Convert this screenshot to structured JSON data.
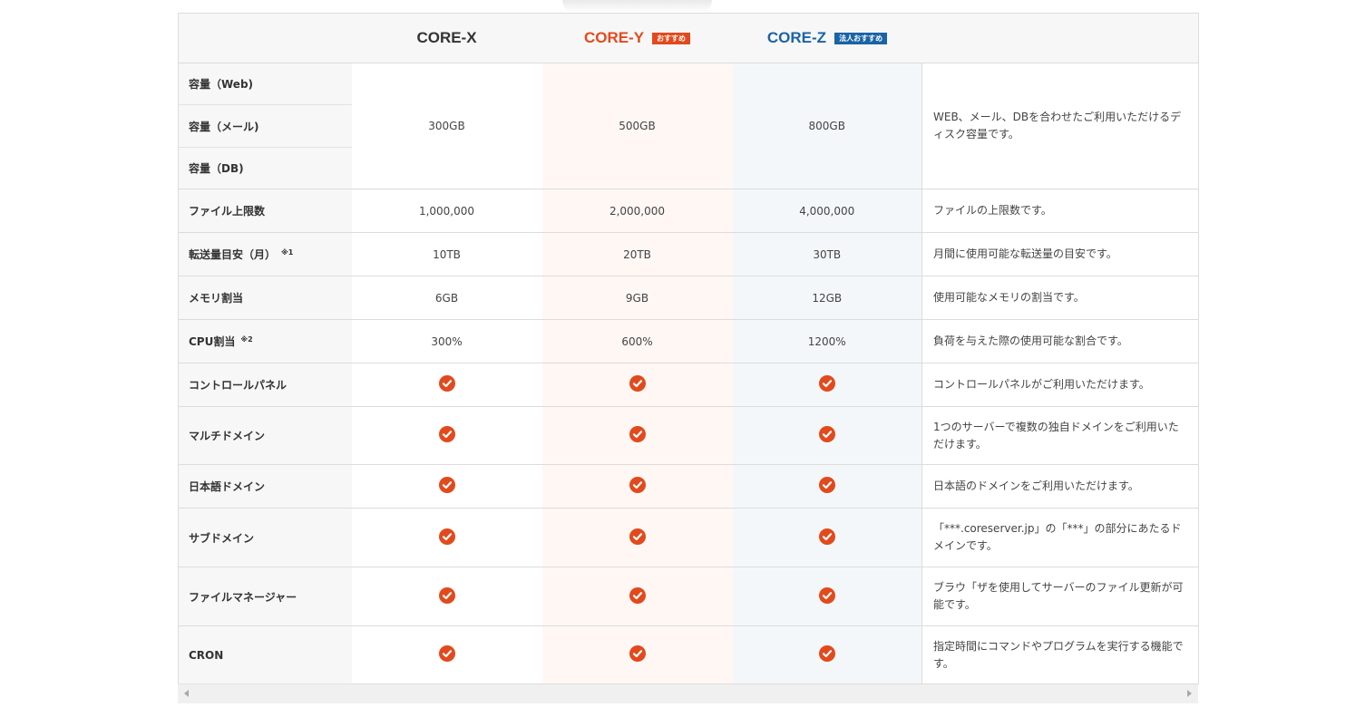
{
  "plans": [
    {
      "name": "CORE-X",
      "badge": "",
      "color": "#333333"
    },
    {
      "name": "CORE-Y",
      "badge": "おすすめ",
      "color": "#e24a1d"
    },
    {
      "name": "CORE-Z",
      "badge": "法人おすすめ",
      "color": "#1a63a6"
    }
  ],
  "storage": {
    "labels": [
      "容量（Web)",
      "容量（メール)",
      "容量（DB)"
    ],
    "values": [
      "300GB",
      "500GB",
      "800GB"
    ],
    "desc": "WEB、メール、DBを合わせたご利用いただけるディスク容量です。"
  },
  "rows": [
    {
      "label": "ファイル上限数",
      "note": "",
      "values": [
        "1,000,000",
        "2,000,000",
        "4,000,000"
      ],
      "desc": "ファイルの上限数です。"
    },
    {
      "label": "転送量目安（月）",
      "note": "※1",
      "values": [
        "10TB",
        "20TB",
        "30TB"
      ],
      "desc": "月間に使用可能な転送量の目安です。"
    },
    {
      "label": "メモリ割当",
      "note": "",
      "values": [
        "6GB",
        "9GB",
        "12GB"
      ],
      "desc": "使用可能なメモリの割当です。"
    },
    {
      "label": "CPU割当",
      "note": "※2",
      "values": [
        "300%",
        "600%",
        "1200%"
      ],
      "desc": "負荷を与えた際の使用可能な割合です。"
    }
  ],
  "features": [
    {
      "label": "コントロールパネル",
      "desc": "コントロールパネルがご利用いただけます。"
    },
    {
      "label": "マルチドメイン",
      "desc": "1つのサーバーで複数の独自ドメインをご利用いただけます。"
    },
    {
      "label": "日本語ドメイン",
      "desc": "日本語のドメインをご利用いただけます。"
    },
    {
      "label": "サブドメイン",
      "desc": "「***.coreserver.jp」の「***」の部分にあたるドメインです。"
    },
    {
      "label": "ファイルマネージャー",
      "desc": "ブラウ「ザを使用してサーバーのファイル更新が可能です。"
    },
    {
      "label": "CRON",
      "desc": "指定時間にコマンドやプログラムを実行する機能です。"
    }
  ],
  "icons": {
    "check": "check-circle-icon",
    "check_color": "#e24a1d"
  }
}
